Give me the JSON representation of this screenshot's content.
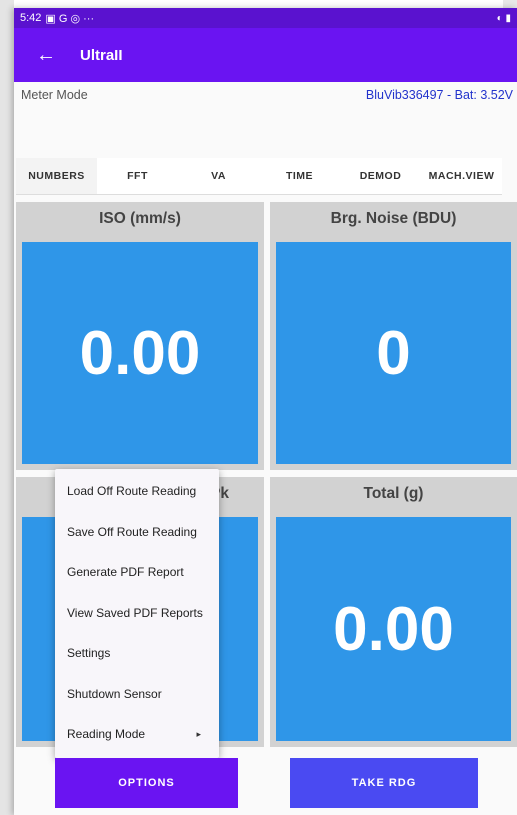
{
  "status_bar": {
    "time": "5:42",
    "icons": "▣ G ◎ ···",
    "right_icons": "◐ ▮"
  },
  "app_bar": {
    "title": "UltraII"
  },
  "meter_mode": "Meter Mode",
  "device_info": "BluVib336497 - Bat: 3.52V",
  "tabs": [
    "NUMBERS",
    "FFT",
    "VA",
    "TIME",
    "DEMOD",
    "MACH.VIEW"
  ],
  "tiles": [
    {
      "label": "ISO (mm/s)",
      "value": "0.00"
    },
    {
      "label": "Brg. Noise (BDU)",
      "value": "0"
    },
    {
      "label": "Pk",
      "value": ""
    },
    {
      "label": "Total (g)",
      "value": "0.00"
    }
  ],
  "menu": {
    "items": [
      "Load Off Route Reading",
      "Save Off Route Reading",
      "Generate PDF Report",
      "View Saved PDF Reports",
      "Settings",
      "Shutdown Sensor",
      "Reading Mode"
    ],
    "submenu_arrow": "▸"
  },
  "buttons": {
    "options": "OPTIONS",
    "take_rdg": "TAKE RDG"
  },
  "colors": {
    "status_bar": "#5a12cf",
    "app_bar": "#6a14f2",
    "tile_bg": "#d2d2d2",
    "tile_value_bg": "#2f96e8",
    "options_button": "#6a14f2",
    "take_rdg_button": "#4a4af2",
    "device_info_text": "#2233cc"
  }
}
